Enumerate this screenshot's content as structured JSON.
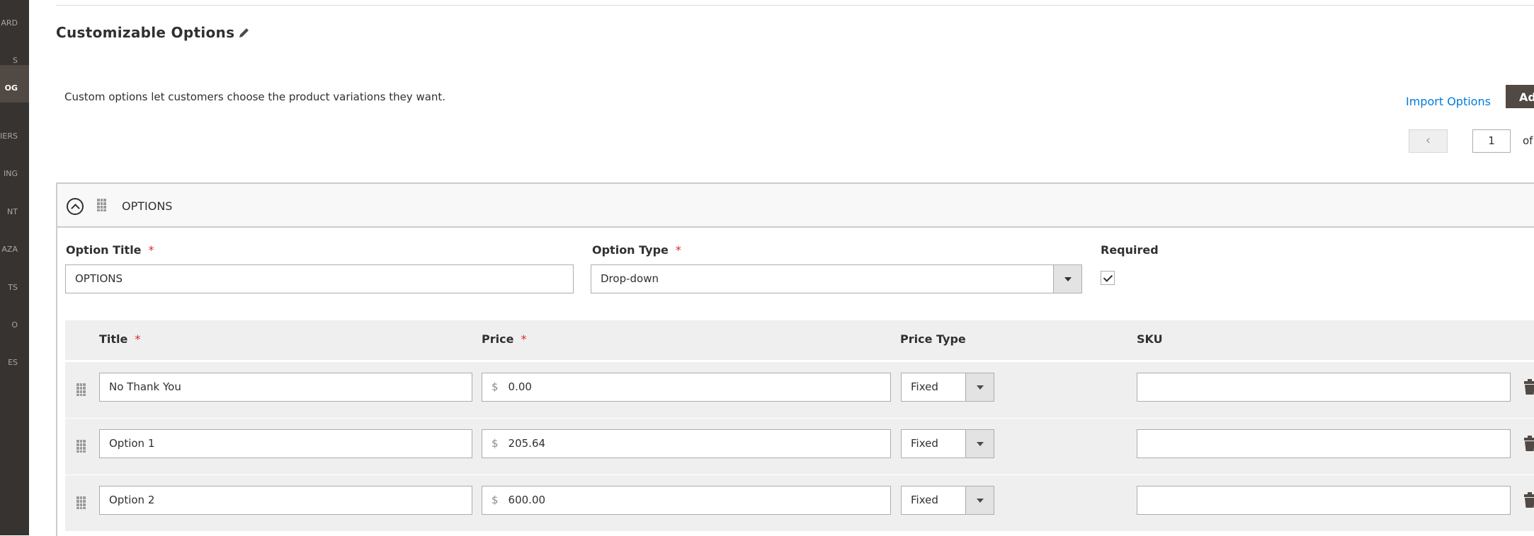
{
  "sidebar": {
    "items": [
      {
        "label": "ARD",
        "active": false
      },
      {
        "label": "S",
        "active": false
      },
      {
        "label": "OG",
        "active": true
      },
      {
        "label": "IERS",
        "active": false
      },
      {
        "label": "ING",
        "active": false
      },
      {
        "label": "NT",
        "active": false
      },
      {
        "label": "AZA",
        "active": false
      },
      {
        "label": "TS",
        "active": false
      },
      {
        "label": "O",
        "active": false
      },
      {
        "label": "ES",
        "active": false
      }
    ]
  },
  "section": {
    "title": "Customizable Options",
    "description": "Custom options let customers choose the product variations they want."
  },
  "actions": {
    "import_label": "Import Options",
    "add_label": "Ad"
  },
  "pager": {
    "prev_icon": "chevron-left",
    "page": "1",
    "of_label": "of"
  },
  "option": {
    "header_title": "OPTIONS",
    "title_label": "Option Title",
    "title_value": "OPTIONS",
    "type_label": "Option Type",
    "type_value": "Drop-down",
    "required_label": "Required",
    "required_checked": true,
    "required_mark": "*"
  },
  "table": {
    "headers": {
      "title": "Title",
      "price": "Price",
      "price_type": "Price Type",
      "sku": "SKU"
    },
    "currency": "$",
    "rows": [
      {
        "title": "No Thank You",
        "price": "0.00",
        "price_type": "Fixed",
        "sku": ""
      },
      {
        "title": "Option 1",
        "price": "205.64",
        "price_type": "Fixed",
        "sku": ""
      },
      {
        "title": "Option 2",
        "price": "600.00",
        "price_type": "Fixed",
        "sku": ""
      }
    ]
  },
  "colors": {
    "sidebar": "#373330",
    "sidebar_active": "#514943",
    "link": "#007bdb",
    "required": "#e22626",
    "row_bg": "#efefef"
  }
}
